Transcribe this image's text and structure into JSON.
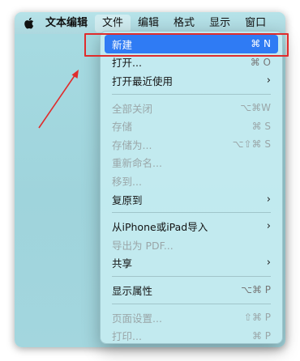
{
  "menubar": {
    "apple": "apple-icon",
    "items": [
      {
        "label": "文本编辑"
      },
      {
        "label": "文件"
      },
      {
        "label": "编辑"
      },
      {
        "label": "格式"
      },
      {
        "label": "显示"
      },
      {
        "label": "窗口"
      }
    ]
  },
  "file_menu": {
    "items": [
      {
        "label": "新建",
        "shortcut": "⌘ N",
        "enabled": true,
        "selected": true
      },
      {
        "label": "打开...",
        "shortcut": "⌘ O",
        "enabled": true
      },
      {
        "label": "打开最近使用",
        "submenu": true,
        "enabled": true
      },
      {
        "label": "全部关闭",
        "shortcut": "⌥⌘W",
        "enabled": false
      },
      {
        "label": "存储",
        "shortcut": "⌘ S",
        "enabled": false
      },
      {
        "label": "存储为...",
        "shortcut": "⌥⇧⌘ S",
        "enabled": false
      },
      {
        "label": "重新命名...",
        "enabled": false
      },
      {
        "label": "移到...",
        "enabled": false
      },
      {
        "label": "复原到",
        "submenu": true,
        "enabled": true
      },
      {
        "label": "从iPhone或iPad导入",
        "submenu": true,
        "enabled": true
      },
      {
        "label": "导出为 PDF...",
        "enabled": false
      },
      {
        "label": "共享",
        "submenu": true,
        "enabled": true
      },
      {
        "label": "显示属性",
        "shortcut": "⌥⌘ P",
        "enabled": true
      },
      {
        "label": "页面设置...",
        "shortcut": "⇧⌘ P",
        "enabled": false
      },
      {
        "label": "打印...",
        "shortcut": "⌘ P",
        "enabled": false
      }
    ],
    "chevron": "›"
  },
  "annotation": {
    "highlight_color": "#e02c2c",
    "target": "新建"
  }
}
